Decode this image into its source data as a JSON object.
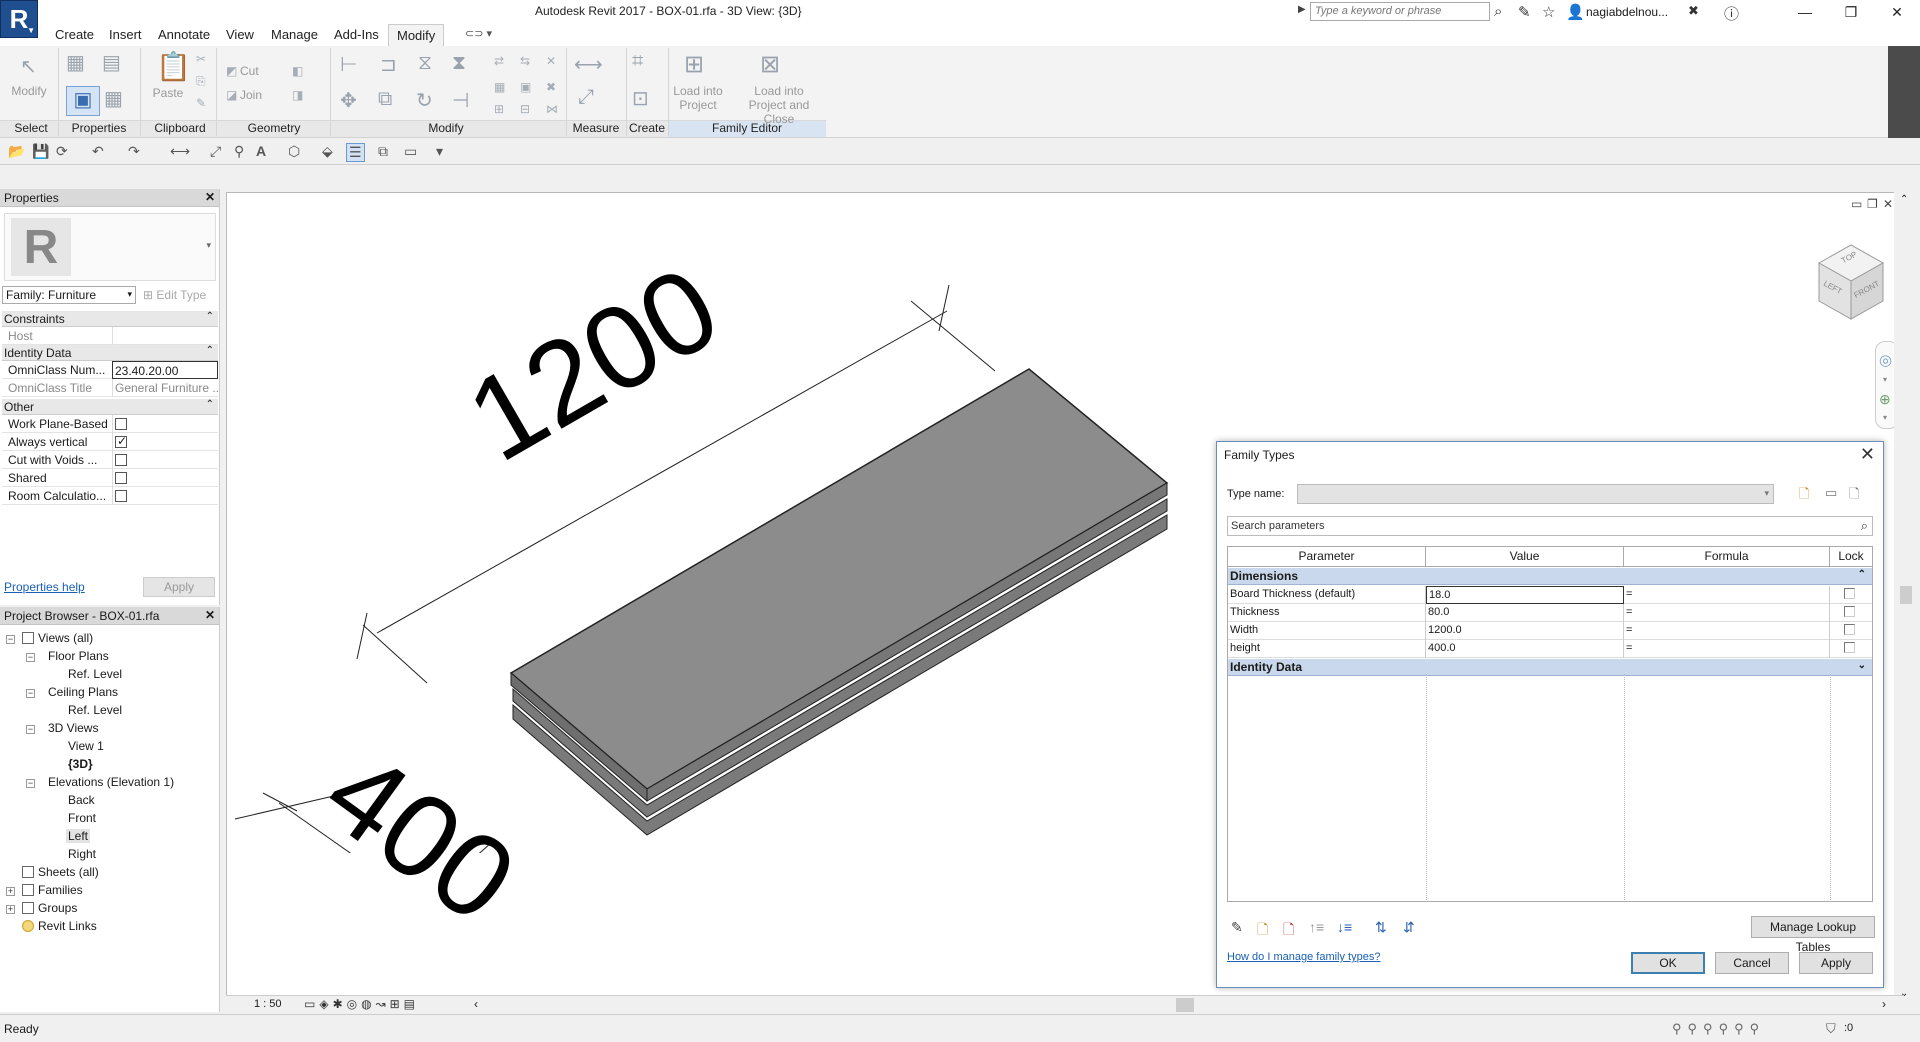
{
  "window": {
    "title": "Autodesk Revit 2017 -     BOX-01.rfa - 3D View: {3D}",
    "search_placeholder": "Type a keyword or phrase",
    "user": "nagiabdelnou...",
    "app_logo_letter": "R"
  },
  "ribbon": {
    "tabs": [
      "Create",
      "Insert",
      "Annotate",
      "View",
      "Manage",
      "Add-Ins",
      "Modify"
    ],
    "active_tab": "Modify",
    "modify_label": "Modify",
    "paste_label": "Paste",
    "cut_label": "Cut",
    "join_label": "Join",
    "load_into_project": "Load into Project",
    "load_into_project_close": "Load into Project and Close",
    "panels": [
      "Select",
      "Properties",
      "Clipboard",
      "Geometry",
      "Modify",
      "Measure",
      "Create",
      "Family Editor"
    ]
  },
  "properties": {
    "title": "Properties",
    "family_selector": "Family: Furniture",
    "edit_type": "Edit Type",
    "sections": {
      "constraints": "Constraints",
      "identity": "Identity Data",
      "other": "Other"
    },
    "host_label": "Host",
    "host_value": "",
    "omniclass_num_label": "OmniClass Num...",
    "omniclass_num_value": "23.40.20.00",
    "omniclass_title_label": "OmniClass Title",
    "omniclass_title_value": "General Furniture ...",
    "other_rows": [
      {
        "label": "Work Plane-Based",
        "checked": false
      },
      {
        "label": "Always vertical",
        "checked": true
      },
      {
        "label": "Cut with Voids ...",
        "checked": false
      },
      {
        "label": "Shared",
        "checked": false
      },
      {
        "label": "Room Calculatio...",
        "checked": false
      }
    ],
    "help_link": "Properties help",
    "apply": "Apply"
  },
  "browser": {
    "title": "Project Browser - BOX-01.rfa",
    "items": {
      "views_all": "Views (all)",
      "floor_plans": "Floor Plans",
      "fp_ref": "Ref. Level",
      "ceiling_plans": "Ceiling Plans",
      "cp_ref": "Ref. Level",
      "views_3d": "3D Views",
      "view1": "View 1",
      "view_3d": "{3D}",
      "elevations": "Elevations (Elevation 1)",
      "back": "Back",
      "front": "Front",
      "left": "Left",
      "right": "Right",
      "sheets": "Sheets (all)",
      "families": "Families",
      "groups": "Groups",
      "revit_links": "Revit Links"
    }
  },
  "viewport": {
    "dim_length": "1200",
    "dim_width": "400",
    "viewcube_top": "TOP",
    "viewcube_front": "FRONT",
    "viewcube_left": "LEFT",
    "scale": "1 : 50"
  },
  "dialog": {
    "title": "Family Types",
    "type_name_label": "Type name:",
    "search_placeholder": "Search parameters",
    "columns": [
      "Parameter",
      "Value",
      "Formula",
      "Lock"
    ],
    "group_dimensions": "Dimensions",
    "group_identity": "Identity Data",
    "rows": [
      {
        "parameter": "Board Thickness (default)",
        "value": "18.0",
        "formula": "="
      },
      {
        "parameter": "Thickness",
        "value": "80.0",
        "formula": "="
      },
      {
        "parameter": "Width",
        "value": "1200.0",
        "formula": "="
      },
      {
        "parameter": "height",
        "value": "400.0",
        "formula": "="
      }
    ],
    "manage_lookup": "Manage Lookup Tables",
    "help_link": "How do I manage family types?",
    "ok": "OK",
    "cancel": "Cancel",
    "apply": "Apply"
  },
  "status": {
    "text": "Ready",
    "filter_count": ":0"
  }
}
